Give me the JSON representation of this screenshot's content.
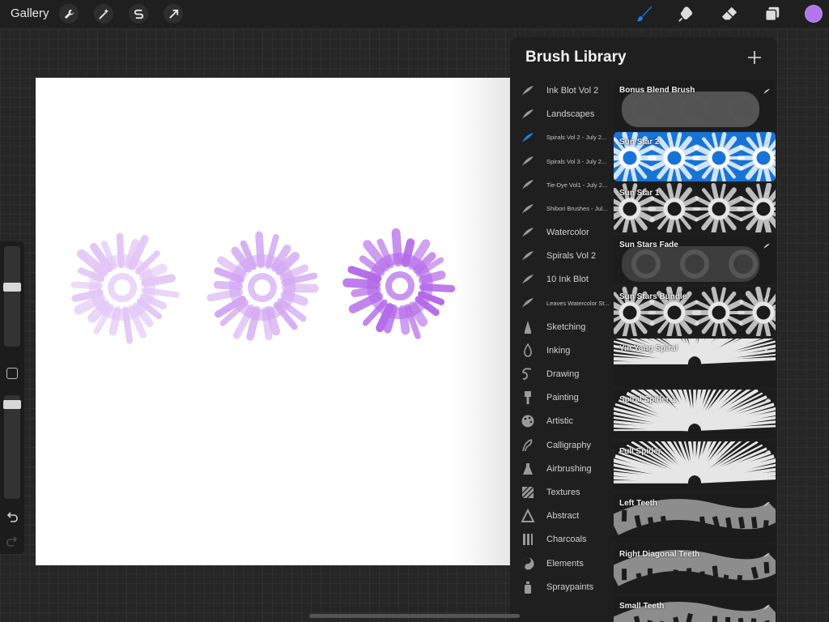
{
  "topbar": {
    "gallery_label": "Gallery",
    "left_tools": [
      "wrench-icon",
      "magic-wand-icon",
      "selection-s-icon",
      "transform-arrow-icon"
    ],
    "right_tools": [
      "brush-icon",
      "smudge-icon",
      "eraser-icon",
      "layers-icon"
    ],
    "active_tool": "brush-icon",
    "current_color": "#b275ec",
    "active_tool_color": "#1a82f2"
  },
  "canvas": {
    "background": "#ffffff",
    "stamp_color": "#a64ee6"
  },
  "sidebar": {
    "brush_size_level": 0.6,
    "opacity_level": 0.95
  },
  "library": {
    "title": "Brush Library",
    "add_icon": "plus-icon",
    "sets": [
      {
        "label": "Ink Blot Vol 2",
        "icon": "feather-icon",
        "small": false,
        "active": false
      },
      {
        "label": "Landscapes",
        "icon": "feather-icon",
        "small": false,
        "active": false
      },
      {
        "label": "Spirals Vol 2 - July 2...",
        "icon": "feather-icon",
        "small": true,
        "active": true
      },
      {
        "label": "Spirals Vol 3 - July 2...",
        "icon": "feather-icon",
        "small": true,
        "active": false
      },
      {
        "label": "Tie-Dye Vol1 - July 2...",
        "icon": "feather-icon",
        "small": true,
        "active": false
      },
      {
        "label": "Shibori Brushes - Jul...",
        "icon": "feather-icon",
        "small": true,
        "active": false
      },
      {
        "label": "Watercolor",
        "icon": "feather-icon",
        "small": false,
        "active": false
      },
      {
        "label": "Spirals Vol 2",
        "icon": "feather-icon",
        "small": false,
        "active": false
      },
      {
        "label": "10 Ink Blot",
        "icon": "feather-icon",
        "small": false,
        "active": false
      },
      {
        "label": "Leaves Watercolor St...",
        "icon": "feather-icon",
        "small": true,
        "active": false
      },
      {
        "label": "Sketching",
        "icon": "pencil-tip-icon",
        "small": false,
        "active": false
      },
      {
        "label": "Inking",
        "icon": "ink-drop-icon",
        "small": false,
        "active": false
      },
      {
        "label": "Drawing",
        "icon": "squiggle-icon",
        "small": false,
        "active": false
      },
      {
        "label": "Painting",
        "icon": "paintbrush-icon",
        "small": false,
        "active": false
      },
      {
        "label": "Artistic",
        "icon": "palette-icon",
        "small": false,
        "active": false
      },
      {
        "label": "Calligraphy",
        "icon": "calligraphy-icon",
        "small": false,
        "active": false
      },
      {
        "label": "Airbrushing",
        "icon": "airbrush-icon",
        "small": false,
        "active": false
      },
      {
        "label": "Textures",
        "icon": "texture-icon",
        "small": false,
        "active": false
      },
      {
        "label": "Abstract",
        "icon": "triangle-icon",
        "small": false,
        "active": false
      },
      {
        "label": "Charcoals",
        "icon": "charcoal-icon",
        "small": false,
        "active": false
      },
      {
        "label": "Elements",
        "icon": "yin-yang-icon",
        "small": false,
        "active": false
      },
      {
        "label": "Spraypaints",
        "icon": "spray-can-icon",
        "small": false,
        "active": false
      }
    ],
    "brushes": [
      {
        "name": "Bonus Blend Brush",
        "selected": false
      },
      {
        "name": "Sun Star 2",
        "selected": true
      },
      {
        "name": "Sun Star 1",
        "selected": false
      },
      {
        "name": "Sun Stars Fade",
        "selected": false
      },
      {
        "name": "Sun Stars Bundle",
        "selected": false
      },
      {
        "name": "Yin Yang Spiral",
        "selected": false
      },
      {
        "name": "Spiral Spider 1",
        "selected": false
      },
      {
        "name": "Full Spider",
        "selected": false
      },
      {
        "name": "Left Teeth",
        "selected": false
      },
      {
        "name": "Right Diagonal Teeth",
        "selected": false
      },
      {
        "name": "Small Teeth",
        "selected": false
      }
    ]
  }
}
